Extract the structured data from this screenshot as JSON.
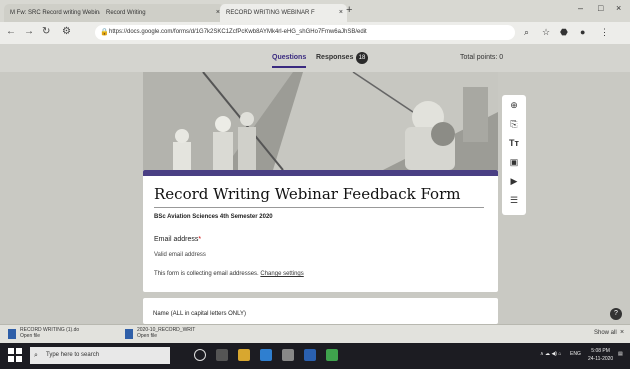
{
  "browser": {
    "tabs": [
      {
        "label": "M Fw: SRC Record writing Webinar"
      },
      {
        "label": "Record Writing"
      },
      {
        "label": "RECORD WRITING WEBINAR F"
      }
    ],
    "new_tab_label": "+",
    "url": "https://docs.google.com/forms/d/1G7k2SKC1ZcfPcKwb8AYMk4rl-eHG_shGHo7Fmw6aJhSB/edit"
  },
  "forms_header": {
    "tab_questions": "Questions",
    "tab_responses": "Responses",
    "responses_count": "18",
    "total_points": "Total points: 0"
  },
  "form": {
    "title": "Record Writing Webinar Feedback Form",
    "description": "BSc Aviation Sciences 4th Semester 2020",
    "email_label": "Email address",
    "email_required_mark": "*",
    "email_placeholder": "Valid email address",
    "collect_note": "This form is collecting email addresses.",
    "change_settings": "Change settings"
  },
  "next_question": {
    "text": "Name (ALL in capital letters ONLY)"
  },
  "downloads": [
    {
      "name": "RECORD WRITING (1).do",
      "size": "Open file"
    },
    {
      "name": "2020-10_RECORD_WRIT",
      "size": "Open file"
    }
  ],
  "download_show_all": "Show all",
  "taskbar": {
    "search_placeholder": "Type here to search",
    "tray_text": "ENG",
    "time": "5:08 PM",
    "date": "24-11-2020"
  },
  "colors": {
    "accent": "#4a3f84",
    "taskbar": "#1c1c22"
  }
}
